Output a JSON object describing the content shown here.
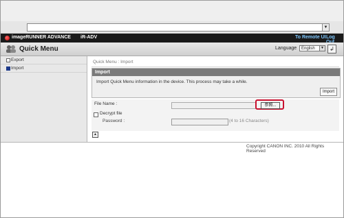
{
  "browser": {
    "address_value": "",
    "dropdown_icon": "chevron-down-icon"
  },
  "header": {
    "brand": "imageRUNNER ADVANCE",
    "model": "iR-ADV",
    "remote_ui_link": "To Remote UI",
    "logout_link": "Log Out",
    "logo_color": "#c00000"
  },
  "titlebar": {
    "title": "Quick Menu",
    "language_label": "Language",
    "language_value": "English",
    "apply_icon": "return-arrow-icon"
  },
  "sidebar": {
    "items": [
      {
        "label": "Export",
        "selected": false
      },
      {
        "label": "Import",
        "selected": true
      }
    ]
  },
  "content": {
    "breadcrumb": "Quick Menu : Import",
    "panel": {
      "heading": "Import",
      "message": "Import Quick Menu information in the device. This process may take a while.",
      "import_button": "Import"
    },
    "form": {
      "file_name_label": "File Name :",
      "file_name_value": "",
      "browse_button": "参照...",
      "decrypt_label": "Decrypt file",
      "decrypt_checked": false,
      "password_label": "Password :",
      "password_value": "",
      "password_hint": "(4 to 16 Characters)"
    },
    "top_icon": "arrow-up-icon"
  },
  "footer": {
    "copyright": "Copyright CANON INC. 2010 All Rights Reserved"
  }
}
